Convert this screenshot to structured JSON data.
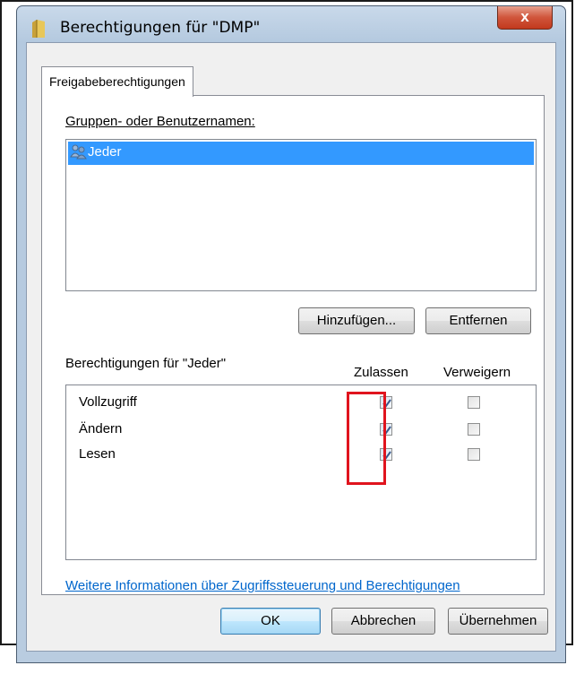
{
  "window": {
    "title": "Berechtigungen für \"DMP\"",
    "close_glyph": "x"
  },
  "tabs": [
    {
      "label": "Freigabeberechtigungen",
      "selected": true
    }
  ],
  "groups": {
    "label": "Gruppen- oder Benutzernamen:",
    "items": [
      {
        "name": "Jeder",
        "selected": true,
        "icon": "users-icon"
      }
    ],
    "add_button": "Hinzufügen...",
    "remove_button": "Entfernen"
  },
  "permissions": {
    "label": "Berechtigungen für \"Jeder\"",
    "allow_header": "Zulassen",
    "deny_header": "Verweigern",
    "rows": [
      {
        "name": "Vollzugriff",
        "allow": true,
        "deny": false
      },
      {
        "name": "Ändern",
        "allow": true,
        "deny": false
      },
      {
        "name": "Lesen",
        "allow": true,
        "deny": false
      }
    ]
  },
  "info_link": "Weitere Informationen über Zugriffssteuerung und Berechtigungen",
  "footer": {
    "ok": "OK",
    "cancel": "Abbrechen",
    "apply": "Übernehmen"
  },
  "colors": {
    "highlight_box": "#e0141e",
    "selection": "#3399ff",
    "link": "#0066cc"
  }
}
